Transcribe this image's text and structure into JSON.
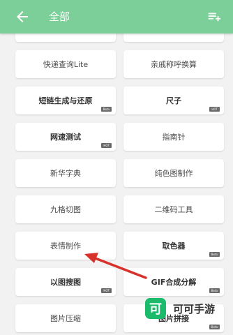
{
  "header": {
    "title": "全部",
    "back_icon": "arrow-left-icon",
    "action_icon": "playlist-add-icon",
    "bg_color": "#7ccf98"
  },
  "tools": [
    {
      "label": "",
      "badge": ""
    },
    {
      "label": "",
      "badge": ""
    },
    {
      "label": "快递查询Lite",
      "badge": ""
    },
    {
      "label": "亲戚称呼换算",
      "badge": ""
    },
    {
      "label": "短链生成与还原",
      "badge": "Beta"
    },
    {
      "label": "尺子",
      "badge": "HOT"
    },
    {
      "label": "网速测试",
      "badge": "HOT"
    },
    {
      "label": "指南针",
      "badge": ""
    },
    {
      "label": "新华字典",
      "badge": ""
    },
    {
      "label": "纯色图制作",
      "badge": ""
    },
    {
      "label": "九格切图",
      "badge": ""
    },
    {
      "label": "二维码工具",
      "badge": ""
    },
    {
      "label": "表情制作",
      "badge": ""
    },
    {
      "label": "取色器",
      "badge": "Beta"
    },
    {
      "label": "以图搜图",
      "badge": "HOT"
    },
    {
      "label": "GIF合成分解",
      "badge": "Beta"
    },
    {
      "label": "图片压缩",
      "badge": ""
    },
    {
      "label": "图片拼接",
      "badge": "Beta"
    }
  ],
  "watermark": {
    "logo_char": "可",
    "text": "可可手游"
  }
}
